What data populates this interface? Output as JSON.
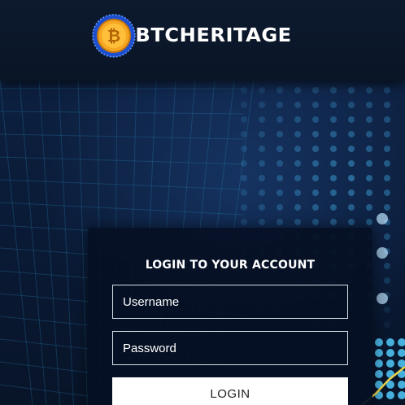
{
  "header": {
    "brand_name": "BTCHERITAGE",
    "logo_icon": "bitcoin-coin-icon"
  },
  "login": {
    "title": "LOGIN TO YOUR ACCOUNT",
    "username_placeholder": "Username",
    "password_placeholder": "Password",
    "submit_label": "LOGIN"
  },
  "colors": {
    "background": "#0a1628",
    "header": "#0d1a2e",
    "panel": "#061024",
    "coin": "#f5a623",
    "coin_ring": "#1e4fd0",
    "grid": "#2a8bbf"
  }
}
